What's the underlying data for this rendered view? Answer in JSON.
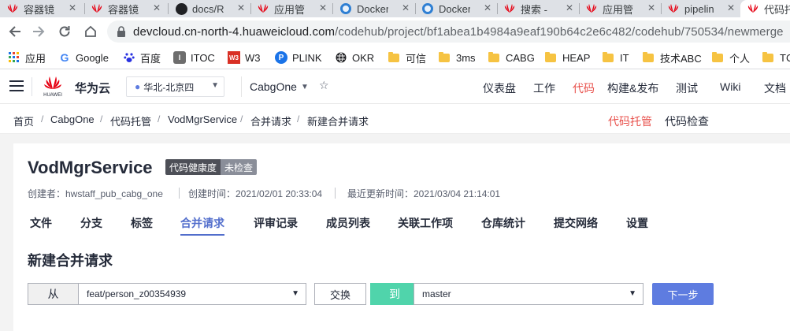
{
  "browser": {
    "tabs": [
      {
        "title": "容器镜",
        "icon": "huawei-icon"
      },
      {
        "title": "容器镜",
        "icon": "huawei-icon"
      },
      {
        "title": "docs/R",
        "icon": "github-icon"
      },
      {
        "title": "应用管",
        "icon": "huawei-icon"
      },
      {
        "title": "Docker",
        "icon": "docker-icon"
      },
      {
        "title": "Docker",
        "icon": "docker-icon"
      },
      {
        "title": "搜索 -",
        "icon": "huawei-icon"
      },
      {
        "title": "应用管",
        "icon": "huawei-icon"
      },
      {
        "title": "pipelin",
        "icon": "huawei-icon"
      },
      {
        "title": "代码托",
        "icon": "huawei-icon"
      }
    ],
    "url_host": "devcloud.cn-north-4.huaweicloud.com",
    "url_path": "/codehub/project/bf1abea1b4984a9eaf190b64c2e6c482/codehub/750534/newmerge",
    "bookmarks": {
      "apps": "应用",
      "google": "Google",
      "baidu": "百度",
      "itoc": "ITOC",
      "w3": "W3",
      "plink": "PLINK",
      "okr": "OKR",
      "kexin": "可信",
      "ms3": "3ms",
      "cabg": "CABG",
      "heap": "HEAP",
      "it": "IT",
      "jishu": "技术ABC",
      "geren": "个人",
      "tc": "TC"
    }
  },
  "header": {
    "brand": "华为云",
    "region": "华北-北京四",
    "project": "CabgOne",
    "nav": {
      "dashboard": "仪表盘",
      "work": "工作",
      "code": "代码",
      "build": "构建&发布",
      "test": "测试",
      "wiki": "Wiki",
      "docs": "文档"
    }
  },
  "breadcrumb": {
    "items": [
      "首页",
      "CabgOne",
      "代码托管",
      "VodMgrService",
      "合并请求",
      "新建合并请求"
    ],
    "subnav": {
      "hosting": "代码托管",
      "check": "代码检查"
    }
  },
  "repo": {
    "name": "VodMgrService",
    "health_label": "代码健康度",
    "health_value": "未检查",
    "creator": "创建者：hwstaff_pub_cabg_one",
    "created": "创建时间：2021/02/01 20:33:04",
    "updated": "最近更新时间：2021/03/04 21:14:01",
    "tabs": {
      "files": "文件",
      "branches": "分支",
      "tags": "标签",
      "merge": "合并请求",
      "reviews": "评审记录",
      "members": "成员列表",
      "workitems": "关联工作项",
      "stats": "仓库统计",
      "network": "提交网络",
      "settings": "设置"
    }
  },
  "merge_form": {
    "title": "新建合并请求",
    "from_label": "从",
    "source_branch": "feat/person_z00354939",
    "swap_label": "交换",
    "to_label": "到",
    "target_branch": "master",
    "next_label": "下一步"
  },
  "colors": {
    "accent_red": "#e8504b",
    "accent_blue": "#526ecc",
    "to_green": "#50d4ab",
    "primary_button": "#5e7ce0"
  }
}
